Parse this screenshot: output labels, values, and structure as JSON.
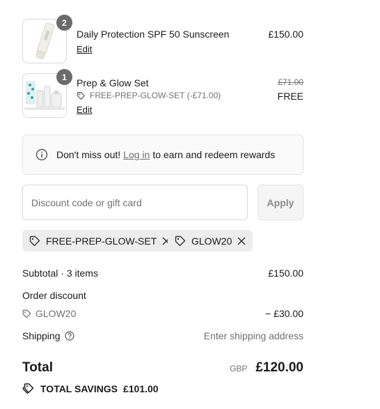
{
  "line_items": [
    {
      "quantity": "2",
      "name": "Daily Protection SPF 50 Sunscreen",
      "edit_label": "Edit",
      "price": "£150.00",
      "thumbnail_icon": "sunscreen-tube-image"
    },
    {
      "quantity": "1",
      "name": "Prep & Glow Set",
      "discount_code": "FREE-PREP-GLOW-SET (-£71.00)",
      "edit_label": "Edit",
      "original_price": "£71.00",
      "price": "FREE",
      "thumbnail_icon": "gift-set-image"
    }
  ],
  "rewards_notice": {
    "text_before": "Don't miss out!",
    "link": "Log in",
    "text_after": "to earn and redeem rewards",
    "icon": "info-icon"
  },
  "discount": {
    "placeholder": "Discount code or gift card",
    "apply_label": "Apply",
    "applied_codes": [
      "FREE-PREP-GLOW-SET",
      "GLOW20"
    ]
  },
  "summary": {
    "subtotal_label": "Subtotal · 3 items",
    "subtotal_value": "£150.00",
    "order_discount_label": "Order discount",
    "discount_code": "GLOW20",
    "discount_value": "− £30.00",
    "shipping_label": "Shipping",
    "shipping_value": "Enter shipping address",
    "total_label": "Total",
    "currency": "GBP",
    "total_value": "£120.00",
    "savings_label": "TOTAL SAVINGS",
    "savings_value": "£101.00"
  },
  "colors": {
    "text": "#1a1a1a",
    "muted": "#707070",
    "badge": "#6b6b6b",
    "chip_bg": "#ededed"
  }
}
